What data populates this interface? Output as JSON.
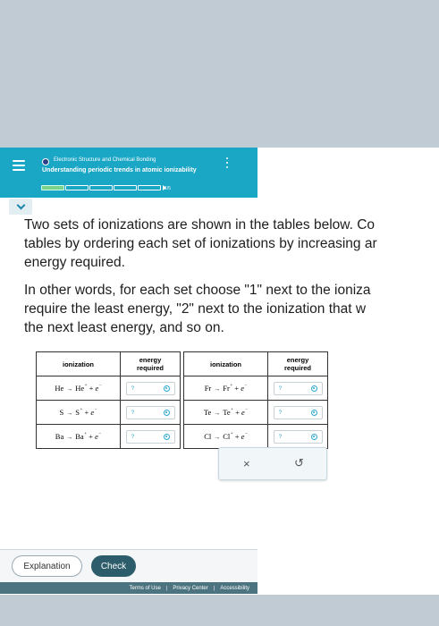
{
  "header": {
    "topic": "Electronic Structure and Chemical Bonding",
    "subtitle": "Understanding periodic trends in atomic ionizability",
    "progress_text": "1/5",
    "progress": {
      "current": 1,
      "total": 5
    }
  },
  "question": {
    "line1": "Two sets of ionizations are shown in the tables below. Co",
    "line2": "tables by ordering each set of ionizations by increasing ar",
    "line3": "energy required.",
    "line4": "In other words, for each set choose \"1\" next to the ioniza",
    "line5": "require the least energy, \"2\" next to the ionization that w",
    "line6": "the next least energy, and so on."
  },
  "tables": {
    "headers": {
      "ionization": "ionization",
      "energy": "energy\nrequired"
    },
    "set1": [
      {
        "atom": "He",
        "ion": "He",
        "charge": "+",
        "electron": "e",
        "echarge": "−",
        "value": "?"
      },
      {
        "atom": "S",
        "ion": "S",
        "charge": "+",
        "electron": "e",
        "echarge": "−",
        "value": "?"
      },
      {
        "atom": "Ba",
        "ion": "Ba",
        "charge": "+",
        "electron": "e",
        "echarge": "−",
        "value": "?"
      }
    ],
    "set2": [
      {
        "atom": "Fr",
        "ion": "Fr",
        "charge": "+",
        "electron": "e",
        "echarge": "−",
        "value": "?"
      },
      {
        "atom": "Te",
        "ion": "Te",
        "charge": "+",
        "electron": "e",
        "echarge": "−",
        "value": "?"
      },
      {
        "atom": "Cl",
        "ion": "Cl",
        "charge": "+",
        "electron": "e",
        "echarge": "−",
        "value": "?"
      }
    ],
    "arrow": "→",
    "plus": "+"
  },
  "answer_box": {
    "clear": "×",
    "undo": "↺"
  },
  "footer": {
    "explanation": "Explanation",
    "check": "Check",
    "terms": "Terms of Use",
    "privacy": "Privacy Center",
    "accessibility": "Accessibility",
    "separator": "|"
  },
  "colors": {
    "header": "#1aa6c5",
    "check": "#2d5c6b",
    "bottom_bar": "#4c7480",
    "progress_fill": "#7bd38b"
  }
}
